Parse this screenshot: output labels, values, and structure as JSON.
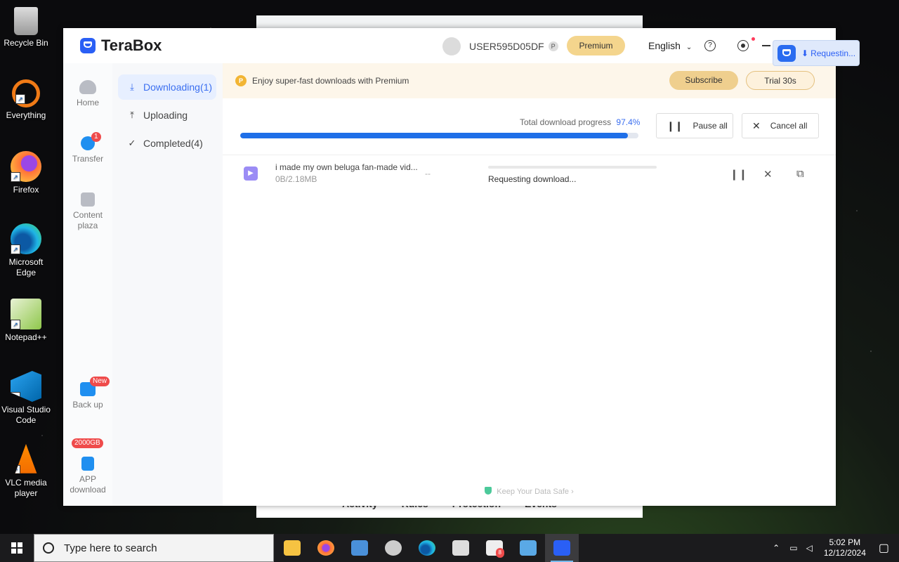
{
  "desktop": {
    "icons": [
      {
        "label": "Recycle Bin"
      },
      {
        "label": "Everything"
      },
      {
        "label": "Firefox"
      },
      {
        "label": "Microsoft Edge"
      },
      {
        "label": "Notepad++"
      },
      {
        "label": "Visual Studio Code"
      },
      {
        "label": "VLC media player"
      }
    ]
  },
  "background_window": {
    "footer_links": [
      "Activity",
      "Rules",
      "Protection",
      "Events"
    ]
  },
  "terabox": {
    "app_name": "TeraBox",
    "username": "USER595D05DF",
    "pbadge": "P",
    "premium_label": "Premium",
    "language": "English",
    "help_symbol": "?",
    "sidebar": {
      "home": "Home",
      "transfer": "Transfer",
      "transfer_badge": "1",
      "content_plaza": "Content plaza",
      "backup": "Back up",
      "backup_badge": "New",
      "app_download": "APP download",
      "app_badge": "2000GB"
    },
    "subnav": {
      "downloading": "Downloading(1)",
      "uploading": "Uploading",
      "completed": "Completed(4)"
    },
    "promo": {
      "text": "Enjoy super-fast downloads with Premium",
      "subscribe": "Subscribe",
      "trial": "Trial 30s"
    },
    "progress": {
      "label": "Total download progress",
      "percent_text": "97.4%",
      "percent": 97.4,
      "pause_all": "Pause all",
      "cancel_all": "Cancel all"
    },
    "task": {
      "name": "i made my own beluga fan-made vid...",
      "size": "0B/2.18MB",
      "speed": "--",
      "status": "Requesting download..."
    },
    "footer": "Keep Your Data Safe",
    "popup": "Requestin..."
  },
  "taskbar": {
    "search_placeholder": "Type here to search",
    "time": "5:02 PM",
    "date": "12/12/2024",
    "mail_badge": "8"
  },
  "colors": {
    "accent": "#1f6fe8",
    "premium_gold": "#f4d58d"
  }
}
